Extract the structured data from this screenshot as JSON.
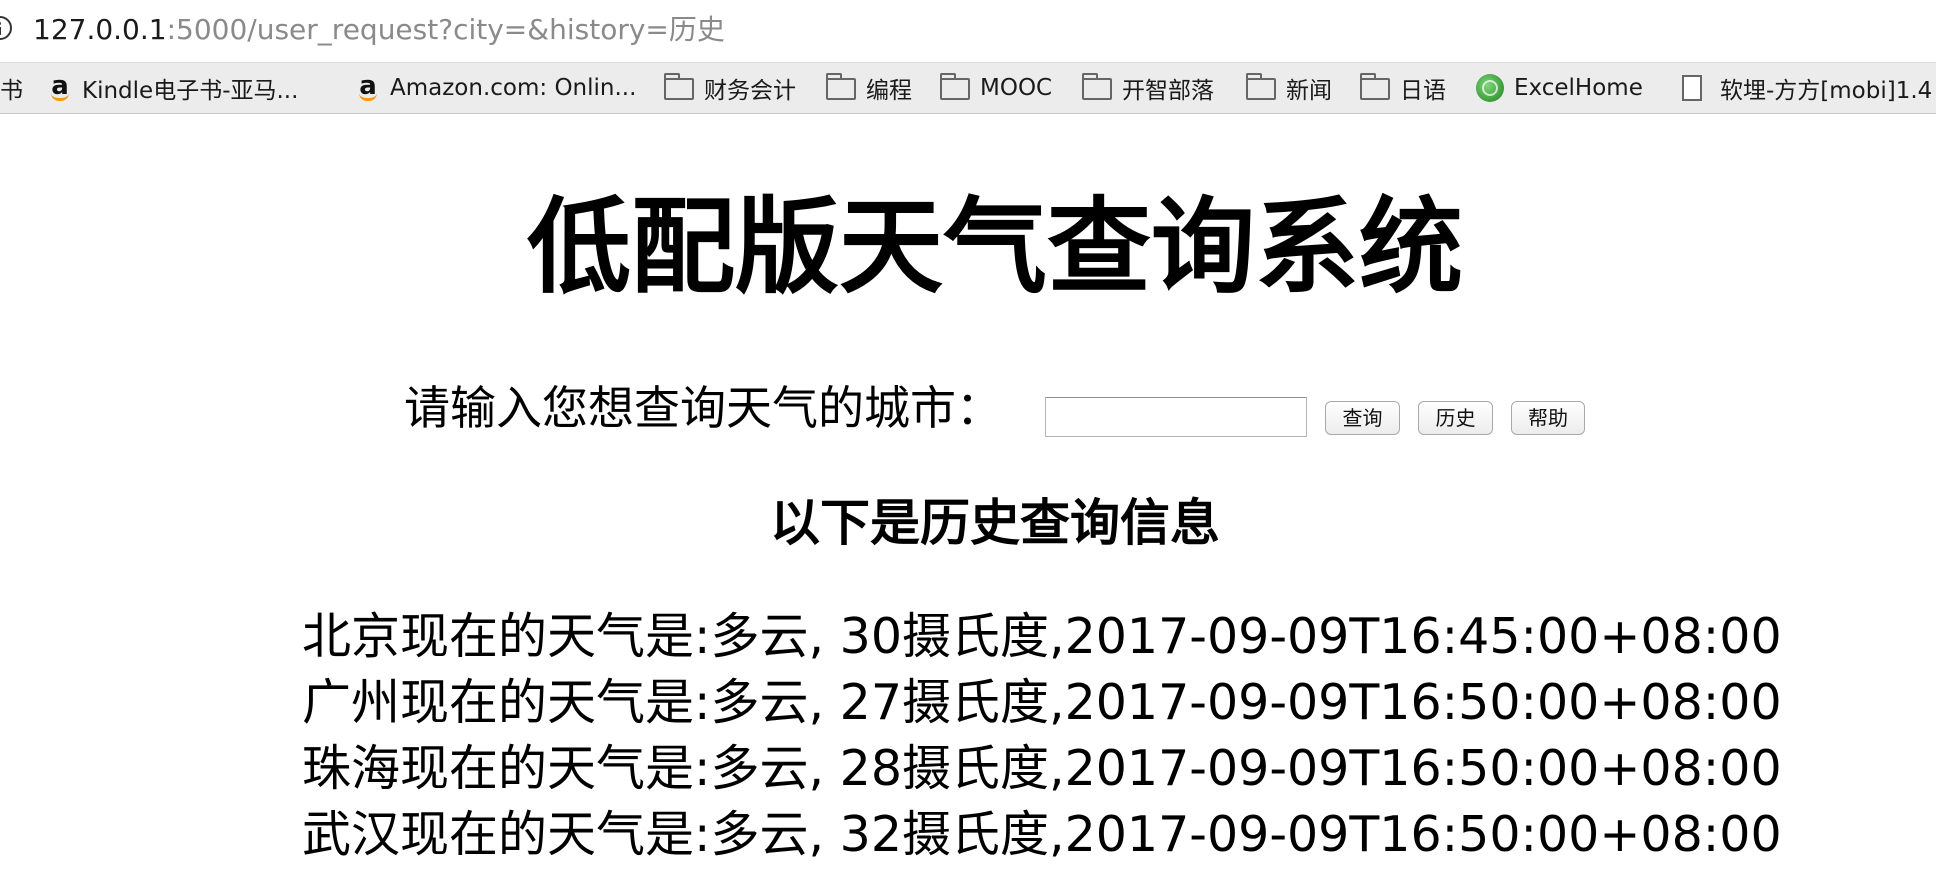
{
  "browser": {
    "url_host": "127.0.0.1",
    "url_rest": ":5000/user_request?city=&history=历史"
  },
  "bookmarks": [
    {
      "label": "书",
      "icon": "none"
    },
    {
      "label": "Kindle电子书-亚马...",
      "icon": "amazon-icon"
    },
    {
      "label": "Amazon.com: Onlin...",
      "icon": "amazon-icon"
    },
    {
      "label": "财务会计",
      "icon": "folder-icon"
    },
    {
      "label": "编程",
      "icon": "folder-icon"
    },
    {
      "label": "MOOC",
      "icon": "folder-icon"
    },
    {
      "label": "开智部落",
      "icon": "folder-icon"
    },
    {
      "label": "新闻",
      "icon": "folder-icon"
    },
    {
      "label": "日语",
      "icon": "folder-icon"
    },
    {
      "label": "ExcelHome",
      "icon": "globe-icon"
    },
    {
      "label": "软埋-方方[mobi]1.4",
      "icon": "document-icon"
    }
  ],
  "page": {
    "title": "低配版天气查询系统",
    "prompt": "请输入您想查询天气的城市：",
    "city_input_value": "",
    "buttons": {
      "query": "查询",
      "history": "历史",
      "help": "帮助"
    },
    "subtitle": "以下是历史查询信息",
    "history": [
      "北京现在的天气是:多云, 30摄氏度,2017-09-09T16:45:00+08:00",
      "广州现在的天气是:多云, 27摄氏度,2017-09-09T16:50:00+08:00",
      "珠海现在的天气是:多云, 28摄氏度,2017-09-09T16:50:00+08:00",
      "武汉现在的天气是:多云, 32摄氏度,2017-09-09T16:50:00+08:00"
    ]
  }
}
